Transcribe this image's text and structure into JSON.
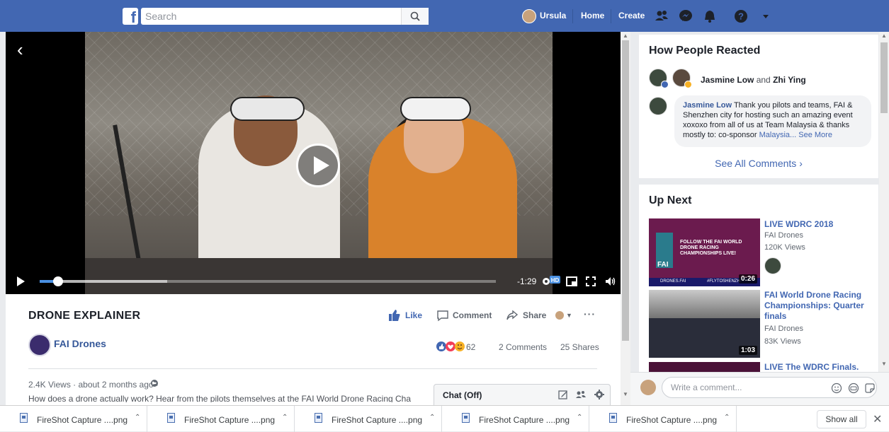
{
  "topbar": {
    "logo": "f",
    "search_placeholder": "Search",
    "user": "Ursula",
    "home": "Home",
    "create": "Create"
  },
  "player": {
    "time_remaining": "-1:29",
    "hd_label": "HD",
    "progress": 0.04,
    "buffered": 0.28
  },
  "post": {
    "title": "DRONE EXPLAINER",
    "page_name": "FAI Drones",
    "actions": {
      "like": "Like",
      "comment": "Comment",
      "share": "Share"
    },
    "reactions_count": "62",
    "comments": "2 Comments",
    "shares": "25 Shares",
    "meta": "2.4K Views · about 2 months ago ·",
    "description": "How does a drone actually work? Hear from the pilots themselves at the FAI World Drone Racing Cha"
  },
  "chat": {
    "label": "Chat (Off)"
  },
  "reactions_panel": {
    "title": "How People Reacted",
    "reactor1": "Jasmine Low",
    "and": "and",
    "reactor2": "Zhi Ying",
    "comment_author": "Jasmine Low",
    "comment_text": "Thank you pilots and teams, FAI & Shenzhen city for hosting such an amazing event xoxoxo from all of us at Team Malaysia & thanks mostly to: co-sponsor",
    "comment_link": "Malaysia...",
    "see_more": "See More",
    "see_all": "See All Comments"
  },
  "up_next": {
    "title": "Up Next",
    "items": [
      {
        "title": "LIVE WDRC 2018",
        "channel": "FAI Drones",
        "views": "120K Views",
        "duration": "0:26"
      },
      {
        "title": "FAI World Drone Racing Championships: Quarter finals",
        "channel": "FAI Drones",
        "views": "83K Views",
        "duration": "1:03"
      },
      {
        "title": "LIVE The WDRC Finals."
      }
    ],
    "thumb1_text": "FOLLOW THE FAI WORLD DRONE RACING CHAMPIONSHIPS LIVE!",
    "thumb1_brand": "FAI",
    "thumb1_footer_left": "DRONES.FAI",
    "thumb1_footer_right": "#FLYTOSHENZH"
  },
  "comment_bar": {
    "placeholder": "Write a comment..."
  },
  "downloads": {
    "items": [
      "FireShot Capture ....png",
      "FireShot Capture ....png",
      "FireShot Capture ....png",
      "FireShot Capture ....png",
      "FireShot Capture ....png"
    ],
    "show_all": "Show all"
  },
  "colors": {
    "brand": "#4267b2",
    "link": "#365899",
    "progress": "#4a90e2"
  }
}
